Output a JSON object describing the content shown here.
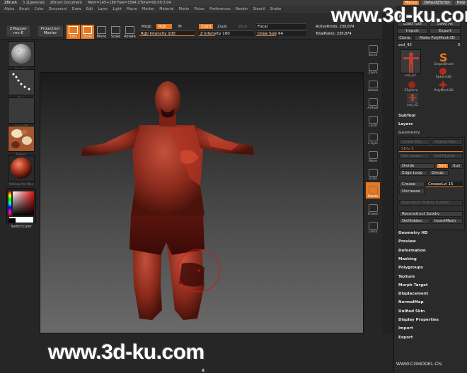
{
  "titlebar": {
    "app": "ZBrush",
    "version": "3.1[general]",
    "document": "ZBrush Document",
    "stats": "Mem=145+189  Free=1594  ZTime=00:00:3.04",
    "menus_pill": "Menus",
    "script_pill": "DefaultZScript",
    "help": "Help"
  },
  "menubar": [
    "Alpha",
    "Brush",
    "Color",
    "Document",
    "Draw",
    "Edit",
    "Layer",
    "Light",
    "Macro",
    "Marker",
    "Material",
    "Movie",
    "Picker",
    "Preferences",
    "Render",
    "Stencil",
    "Stroke"
  ],
  "toolbar": {
    "zmapper": "ZMapper",
    "zmapper_sub": "rev-E",
    "projection": "Projection",
    "projection_sub": "Master",
    "modes": [
      {
        "label": "Edit",
        "active": true
      },
      {
        "label": "Draw",
        "active": true
      },
      {
        "label": "Move",
        "active": false
      },
      {
        "label": "Scale",
        "active": false
      },
      {
        "label": "Rotate",
        "active": false
      }
    ],
    "mrgb": "Mrgb",
    "rgb": "Rgb",
    "m": "M",
    "rgb_intensity": "Rgb Intensity 100",
    "zadd": "Zadd",
    "zsub": "Zsub",
    "zcut": "Zcut",
    "z_intensity": "Z Intensity 100",
    "focal_shift": "Focal",
    "draw_size": "Draw Size 64",
    "active_points": "ActivePoints: 230,874",
    "total_points": "TotalPoints: 230,874"
  },
  "left_shelf": {
    "brush_label": "Standard",
    "stroke_label": "Dots",
    "alpha_label": "Alpha Off",
    "texture_label": "Texture",
    "material_label": "MatCap Red Wax",
    "switch_color": "SwitchColor",
    "fill_color": "#ffffff"
  },
  "right_nav": [
    "Scroll",
    "Zoom",
    "Actual",
    "AAHalf",
    "Local",
    "L.Sym",
    "Move",
    "Scale",
    "Rotate",
    "Frame",
    "Lasso"
  ],
  "palette": {
    "title": "Tool",
    "load_tool": "Load Tool",
    "save_as": "Save As",
    "import": "Import",
    "export": "Export",
    "clone": "Clone",
    "make_polymesh": "Make PolyMesh3D",
    "tool_name": "zsd_42",
    "count": "5",
    "thumbs": [
      "zsd_42",
      "SimpleBrush",
      "Sphere3D",
      "ZSphere",
      "PolyMesh3D",
      "zsd_42"
    ],
    "subtool": "SubTool",
    "layers": "Layers",
    "geometry": "Geometry",
    "lower_res": "Lower Res",
    "higher_res": "Higher Res",
    "sdiv": "SDiv 5",
    "del_lower": "Del Lower",
    "del_higher": "Del Higher",
    "divide": "Divide",
    "smt": "Smt",
    "suv": "Suv",
    "edge_loop": "Edge Loop",
    "group": "Group",
    "crease": "Crease",
    "crease_lvl": "CreaseLvl 15",
    "uncrease": "Uncrease",
    "reproject": "Reproject Higher Subdiv",
    "reconstruct": "Reconstruct Subdiv",
    "delhidden": "DelHidden",
    "insertmesh": "InsertMesh",
    "sections": [
      "Geometry HD",
      "Preview",
      "Deformation",
      "Masking",
      "Polygroups",
      "Texture",
      "Morph Target",
      "Displacement",
      "NormalMap",
      "Unified Skin",
      "Display Properties",
      "Import",
      "Export"
    ]
  },
  "watermarks": {
    "top": "www.3d-ku.com",
    "bottom": "www.3d-ku.com",
    "cgmodel": "WWW.CGMODEL.CN"
  }
}
